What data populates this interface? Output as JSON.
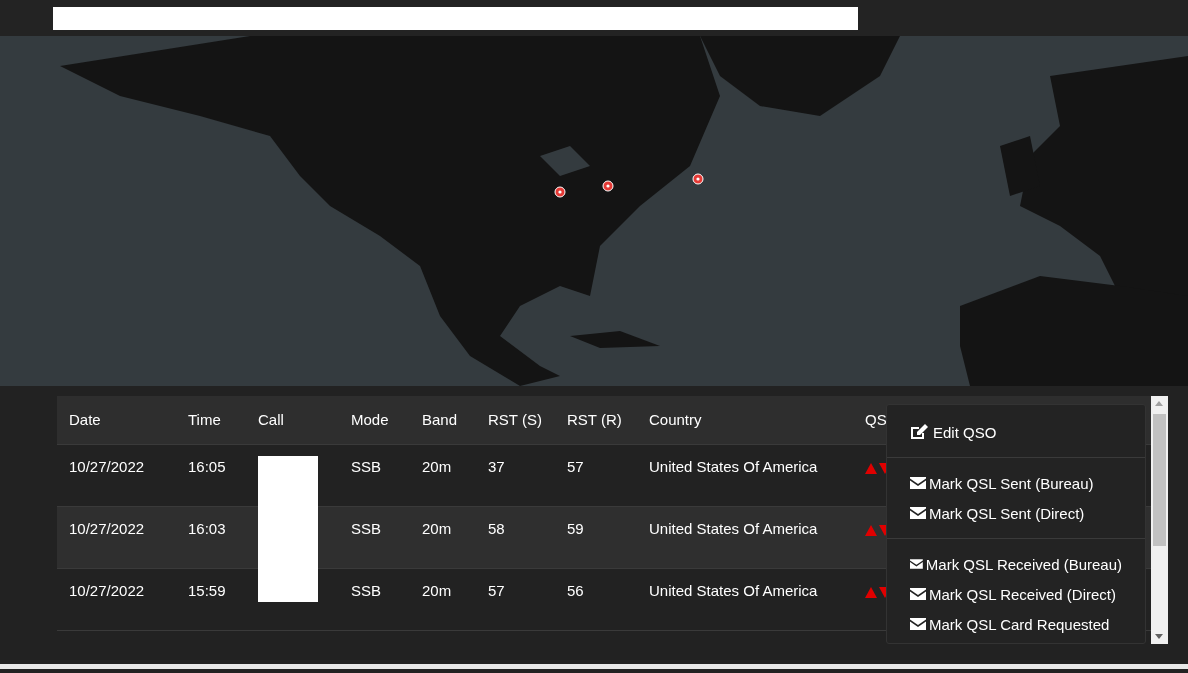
{
  "table": {
    "columns": [
      "Date",
      "Time",
      "Call",
      "Mode",
      "Band",
      "RST (S)",
      "RST (R)",
      "Country",
      "QS"
    ],
    "rows": [
      {
        "date": "10/27/2022",
        "time": "16:05",
        "mode": "SSB",
        "band": "20m",
        "rst_sent": "37",
        "rst_received": "57",
        "country": "United States Of America",
        "qsl_sent": false,
        "qsl_received": false,
        "selected": false
      },
      {
        "date": "10/27/2022",
        "time": "16:03",
        "mode": "SSB",
        "band": "20m",
        "rst_sent": "58",
        "rst_received": "59",
        "country": "United States Of America",
        "qsl_sent": false,
        "qsl_received": false,
        "selected": true
      },
      {
        "date": "10/27/2022",
        "time": "15:59",
        "mode": "SSB",
        "band": "20m",
        "rst_sent": "57",
        "rst_received": "56",
        "country": "United States Of America",
        "qsl_sent": false,
        "qsl_received": false,
        "selected": false
      }
    ]
  },
  "context_menu": {
    "groups": [
      [
        {
          "label": "Edit QSO",
          "kind": "edit"
        }
      ],
      [
        {
          "label": "Mark QSL Sent (Bureau)",
          "kind": "mail"
        },
        {
          "label": "Mark QSL Sent (Direct)",
          "kind": "mail"
        }
      ],
      [
        {
          "label": "Mark QSL Received (Bureau)",
          "kind": "mail"
        },
        {
          "label": "Mark QSL Received (Direct)",
          "kind": "mail"
        },
        {
          "label": "Mark QSL Card Requested",
          "kind": "mail"
        }
      ]
    ]
  }
}
